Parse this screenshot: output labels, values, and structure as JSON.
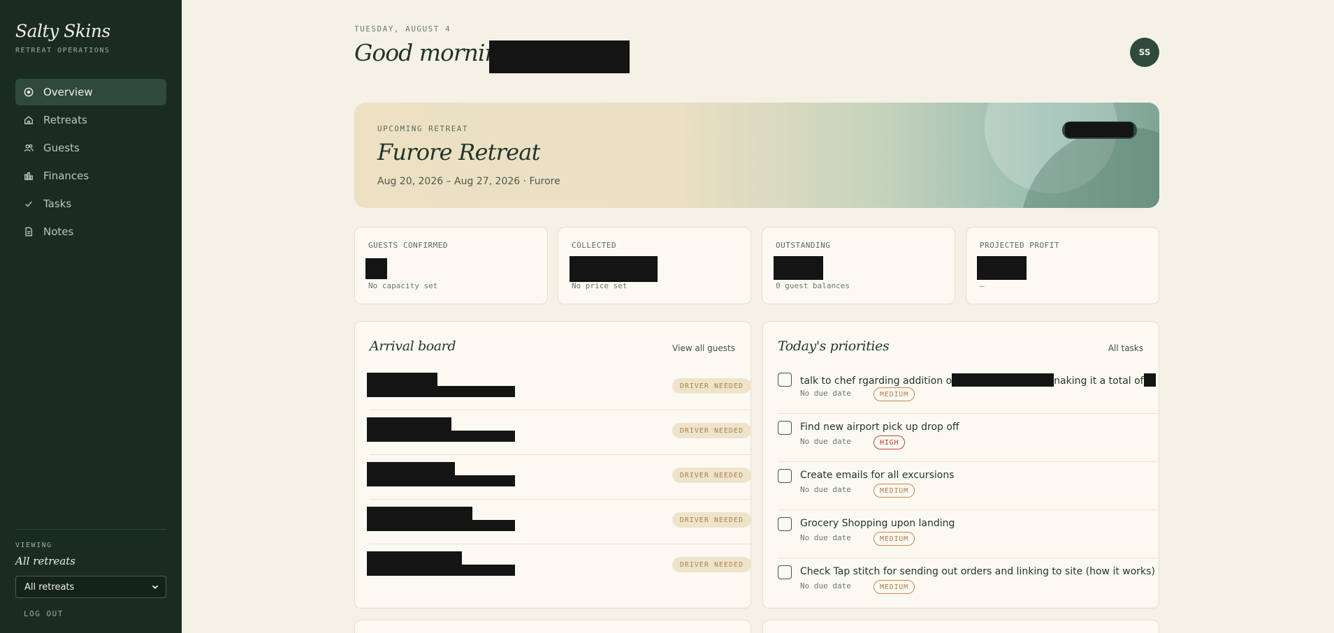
{
  "app": {
    "brand": "Salty Skins",
    "brand_sub": "RETREAT OPERATIONS"
  },
  "sidebar": {
    "items": [
      {
        "label": "Overview",
        "icon": "target-icon",
        "active": true
      },
      {
        "label": "Retreats",
        "icon": "home-icon"
      },
      {
        "label": "Guests",
        "icon": "users-icon"
      },
      {
        "label": "Finances",
        "icon": "bar-chart-icon"
      },
      {
        "label": "Tasks",
        "icon": "check-icon"
      },
      {
        "label": "Notes",
        "icon": "document-icon"
      }
    ],
    "viewing_label": "VIEWING",
    "viewing_value": "All retreats",
    "select_value": "All retreats",
    "logout": "LOG OUT"
  },
  "header": {
    "date": "TUESDAY, AUGUST 4",
    "greeting": "Good morning,",
    "avatar": "SS"
  },
  "hero": {
    "label": "UPCOMING RETREAT",
    "title": "Furore Retreat",
    "dates": "Aug 20, 2026 – Aug 27, 2026 · Furore"
  },
  "stats": [
    {
      "label": "GUESTS CONFIRMED",
      "sub": "No capacity set"
    },
    {
      "label": "COLLECTED",
      "sub": "No price set"
    },
    {
      "label": "OUTSTANDING",
      "sub": "0 guest balances"
    },
    {
      "label": "PROJECTED PROFIT",
      "sub": "—"
    }
  ],
  "arrivals": {
    "title": "Arrival board",
    "link": "View all guests",
    "badge": "DRIVER NEEDED"
  },
  "priorities": {
    "title": "Today's priorities",
    "link": "All tasks",
    "due": "No due date",
    "tasks": [
      {
        "text_before": "talk to chef rgarding addition o",
        "text_after": "naking it a total of",
        "priority": "MEDIUM"
      },
      {
        "text": "Find new airport pick up drop off",
        "priority": "HIGH"
      },
      {
        "text": "Create emails for all excursions",
        "priority": "MEDIUM"
      },
      {
        "text": "Grocery Shopping upon landing",
        "priority": "MEDIUM"
      },
      {
        "text": "Check Tap stitch for sending out orders and linking to site (how it works)",
        "priority": "MEDIUM"
      }
    ]
  },
  "colors": {
    "sidebar_bg": "#1a2b24",
    "page_bg": "#f5f1e6",
    "accent": "#2e4a3d",
    "medium": "#c98a4a",
    "high": "#c0483a"
  }
}
